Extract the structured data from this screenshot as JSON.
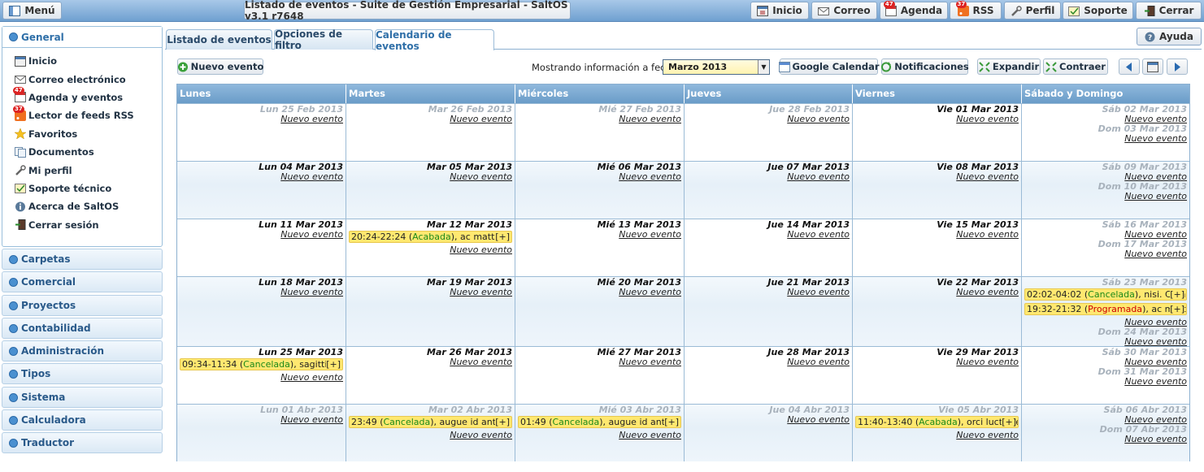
{
  "topbar": {
    "menu": "Menú",
    "title": "Listado de eventos - Suite de Gestión Empresarial - SaltOS v3.1 r7648",
    "buttons": [
      {
        "label": "Inicio"
      },
      {
        "label": "Correo"
      },
      {
        "label": "Agenda",
        "badge": "47"
      },
      {
        "label": "RSS",
        "badge": "37"
      },
      {
        "label": "Perfil"
      },
      {
        "label": "Soporte"
      },
      {
        "label": "Cerrar"
      }
    ]
  },
  "sidebar": {
    "open_section": "General",
    "items": [
      {
        "label": "Inicio",
        "icon": "home-icon"
      },
      {
        "label": "Correo electrónico",
        "icon": "mail-icon"
      },
      {
        "label": "Agenda y eventos",
        "icon": "calendar-icon",
        "badge": "47"
      },
      {
        "label": "Lector de feeds RSS",
        "icon": "rss-icon",
        "badge": "37"
      },
      {
        "label": "Favoritos",
        "icon": "star-icon"
      },
      {
        "label": "Documentos",
        "icon": "documents-icon"
      },
      {
        "label": "Mi perfil",
        "icon": "wrench-icon"
      },
      {
        "label": "Soporte técnico",
        "icon": "support-icon"
      },
      {
        "label": "Acerca de SaltOS",
        "icon": "info-icon"
      },
      {
        "label": "Cerrar sesión",
        "icon": "exit-icon"
      }
    ],
    "sections": [
      "Carpetas",
      "Comercial",
      "Proyectos",
      "Contabilidad",
      "Administración",
      "Tipos",
      "Sistema",
      "Calculadora",
      "Traductor"
    ]
  },
  "tabs": [
    "Listado de eventos",
    "Opciones de filtro",
    "Calendario de eventos"
  ],
  "help": "Ayuda",
  "toolbar": {
    "new_event": "Nuevo evento",
    "showing_label": "Mostrando información a fecha:",
    "date_value": "Marzo 2013",
    "google": "Google Calendar",
    "notifications": "Notificaciones",
    "expand": "Expandir",
    "contract": "Contraer"
  },
  "calendar": {
    "headers": [
      "Lunes",
      "Martes",
      "Miércoles",
      "Jueves",
      "Viernes",
      "Sábado y Domingo"
    ],
    "new_event_link": "Nuevo evento",
    "weeks": [
      [
        {
          "days": [
            {
              "label": "Lun 25 Feb 2013",
              "dim": true
            }
          ]
        },
        {
          "days": [
            {
              "label": "Mar 26 Feb 2013",
              "dim": true
            }
          ]
        },
        {
          "days": [
            {
              "label": "Mié 27 Feb 2013",
              "dim": true
            }
          ]
        },
        {
          "days": [
            {
              "label": "Jue 28 Feb 2013",
              "dim": true
            }
          ]
        },
        {
          "days": [
            {
              "label": "Vie 01 Mar 2013"
            }
          ]
        },
        {
          "days": [
            {
              "label": "Sáb 02 Mar 2013",
              "dim": true
            },
            {
              "label": "Dom 03 Mar 2013",
              "dim": true
            }
          ]
        }
      ],
      [
        {
          "days": [
            {
              "label": "Lun 04 Mar 2013"
            }
          ]
        },
        {
          "days": [
            {
              "label": "Mar 05 Mar 2013"
            }
          ]
        },
        {
          "days": [
            {
              "label": "Mié 06 Mar 2013"
            }
          ]
        },
        {
          "days": [
            {
              "label": "Jue 07 Mar 2013"
            }
          ]
        },
        {
          "days": [
            {
              "label": "Vie 08 Mar 2013"
            }
          ]
        },
        {
          "days": [
            {
              "label": "Sáb 09 Mar 2013",
              "dim": true
            },
            {
              "label": "Dom 10 Mar 2013",
              "dim": true
            }
          ]
        }
      ],
      [
        {
          "days": [
            {
              "label": "Lun 11 Mar 2013"
            }
          ]
        },
        {
          "days": [
            {
              "label": "Mar 12 Mar 2013",
              "events": [
                {
                  "time": "20:24-22:24",
                  "status": "Acabada",
                  "text": ", ac mattis"
                }
              ]
            }
          ]
        },
        {
          "days": [
            {
              "label": "Mié 13 Mar 2013"
            }
          ]
        },
        {
          "days": [
            {
              "label": "Jue 14 Mar 2013"
            }
          ]
        },
        {
          "days": [
            {
              "label": "Vie 15 Mar 2013"
            }
          ]
        },
        {
          "days": [
            {
              "label": "Sáb 16 Mar 2013",
              "dim": true
            },
            {
              "label": "Dom 17 Mar 2013",
              "dim": true
            }
          ]
        }
      ],
      [
        {
          "days": [
            {
              "label": "Lun 18 Mar 2013"
            }
          ]
        },
        {
          "days": [
            {
              "label": "Mar 19 Mar 2013"
            }
          ]
        },
        {
          "days": [
            {
              "label": "Mié 20 Mar 2013"
            }
          ]
        },
        {
          "days": [
            {
              "label": "Jue 21 Mar 2013"
            }
          ]
        },
        {
          "days": [
            {
              "label": "Vie 22 Mar 2013"
            }
          ]
        },
        {
          "days": [
            {
              "label": "Sáb 23 Mar 2013",
              "dim": true,
              "events": [
                {
                  "time": "02:02-04:02",
                  "status": "Cancelada",
                  "text": ", nisi. Cum"
                },
                {
                  "time": "19:32-21:32",
                  "status": "Programada",
                  "red": true,
                  "text": ", ac mattis"
                }
              ]
            },
            {
              "label": "Dom 24 Mar 2013",
              "dim": true
            }
          ]
        }
      ],
      [
        {
          "days": [
            {
              "label": "Lun 25 Mar 2013",
              "events": [
                {
                  "time": "09:34-11:34",
                  "status": "Cancelada",
                  "text": ", sagittis"
                }
              ]
            }
          ]
        },
        {
          "days": [
            {
              "label": "Mar 26 Mar 2013"
            }
          ]
        },
        {
          "days": [
            {
              "label": "Mié 27 Mar 2013"
            }
          ]
        },
        {
          "days": [
            {
              "label": "Jue 28 Mar 2013"
            }
          ]
        },
        {
          "days": [
            {
              "label": "Vie 29 Mar 2013"
            }
          ]
        },
        {
          "days": [
            {
              "label": "Sáb 30 Mar 2013",
              "dim": true
            },
            {
              "label": "Dom 31 Mar 2013",
              "dim": true
            }
          ]
        }
      ],
      [
        {
          "days": [
            {
              "label": "Lun 01 Abr 2013",
              "dim": true
            }
          ]
        },
        {
          "days": [
            {
              "label": "Mar 02 Abr 2013",
              "dim": true,
              "events": [
                {
                  "time": "23:49",
                  "status": "Cancelada",
                  "text": ", augue id ante"
                }
              ]
            }
          ]
        },
        {
          "days": [
            {
              "label": "Mié 03 Abr 2013",
              "dim": true,
              "events": [
                {
                  "time": "01:49",
                  "status": "Cancelada",
                  "text": ", augue id ante"
                }
              ]
            }
          ]
        },
        {
          "days": [
            {
              "label": "Jue 04 Abr 2013",
              "dim": true
            }
          ]
        },
        {
          "days": [
            {
              "label": "Vie 05 Abr 2013",
              "dim": true,
              "events": [
                {
                  "time": "11:40-13:40",
                  "status": "Acabada",
                  "text": ", orci luctus et"
                }
              ]
            }
          ]
        },
        {
          "days": [
            {
              "label": "Sáb 06 Abr 2013",
              "dim": true
            },
            {
              "label": "Dom 07 Abr 2013",
              "dim": true
            }
          ]
        }
      ]
    ],
    "more": "[+]"
  },
  "colors": {
    "accent": "#2f6fa8",
    "event_bg": "#ffe870",
    "status_green": "#1a8a1a",
    "status_red": "#cc0000"
  }
}
